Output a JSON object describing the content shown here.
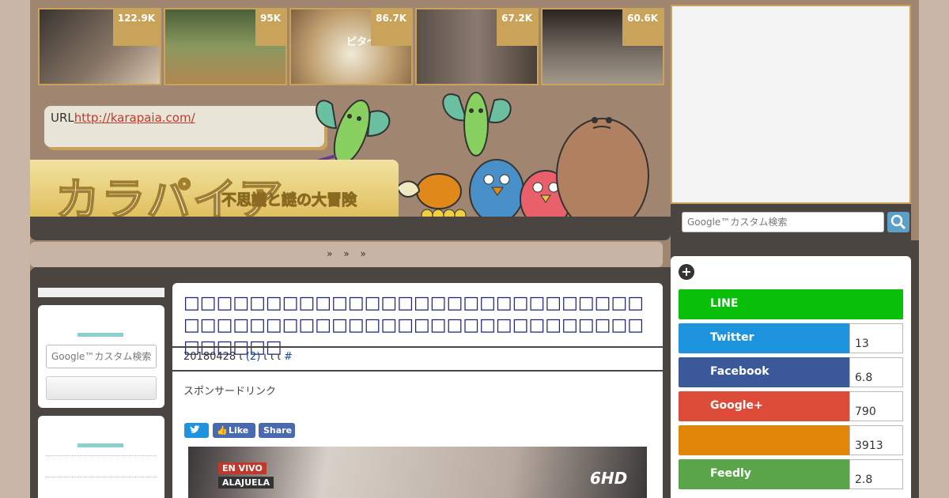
{
  "thumbnails": [
    {
      "count": "122.9K",
      "bg": "#5a5048"
    },
    {
      "count": "95K",
      "bg": "#7a8858"
    },
    {
      "count": "86.7K",
      "bg": "#b89a70"
    },
    {
      "count": "67.2K",
      "bg": "#706058"
    },
    {
      "count": "60.6K",
      "bg": "#605850"
    }
  ],
  "thumb_caption": "ピタ〜",
  "url_bubble": {
    "prefix": "URL",
    "link": "http://karapaia.com/"
  },
  "logo": {
    "title": "カラパイア",
    "subtitle": "不思議と謎の大冒険"
  },
  "nav": {
    "items": [
      "»",
      "»",
      "»"
    ]
  },
  "search": {
    "placeholder": "Google™カスタム検索"
  },
  "article": {
    "title": "□□□□□□□□□□□□□□□□□□□□□□□□□□□□□□□□□□□□□□□□□□□□□□□□□□□□□□□□□□□□□□",
    "meta_date": "20180428",
    "meta_sep1": "ι",
    "meta_comments": "(2)",
    "meta_marks": "ι ι ι",
    "meta_hash": "#",
    "sponsor": "スポンサードリンク",
    "share_buttons": {
      "twitter": "",
      "like": "Like",
      "share": "Share"
    },
    "video": {
      "live": "EN VIVO",
      "location": "ALAJUELA",
      "channel": "6HD"
    }
  },
  "share": [
    {
      "label": "LINE",
      "count": "",
      "color": "#0abf0a"
    },
    {
      "label": "Twitter",
      "count": "13",
      "color": "#1d94dd"
    },
    {
      "label": "Facebook",
      "count": "6.8",
      "color": "#3b5998"
    },
    {
      "label": "Google+",
      "count": "790",
      "color": "#dd4b39"
    },
    {
      "label": "",
      "count": "3913",
      "color": "#e0870a"
    },
    {
      "label": "Feedly",
      "count": "2.8",
      "color": "#5aa54a"
    }
  ]
}
